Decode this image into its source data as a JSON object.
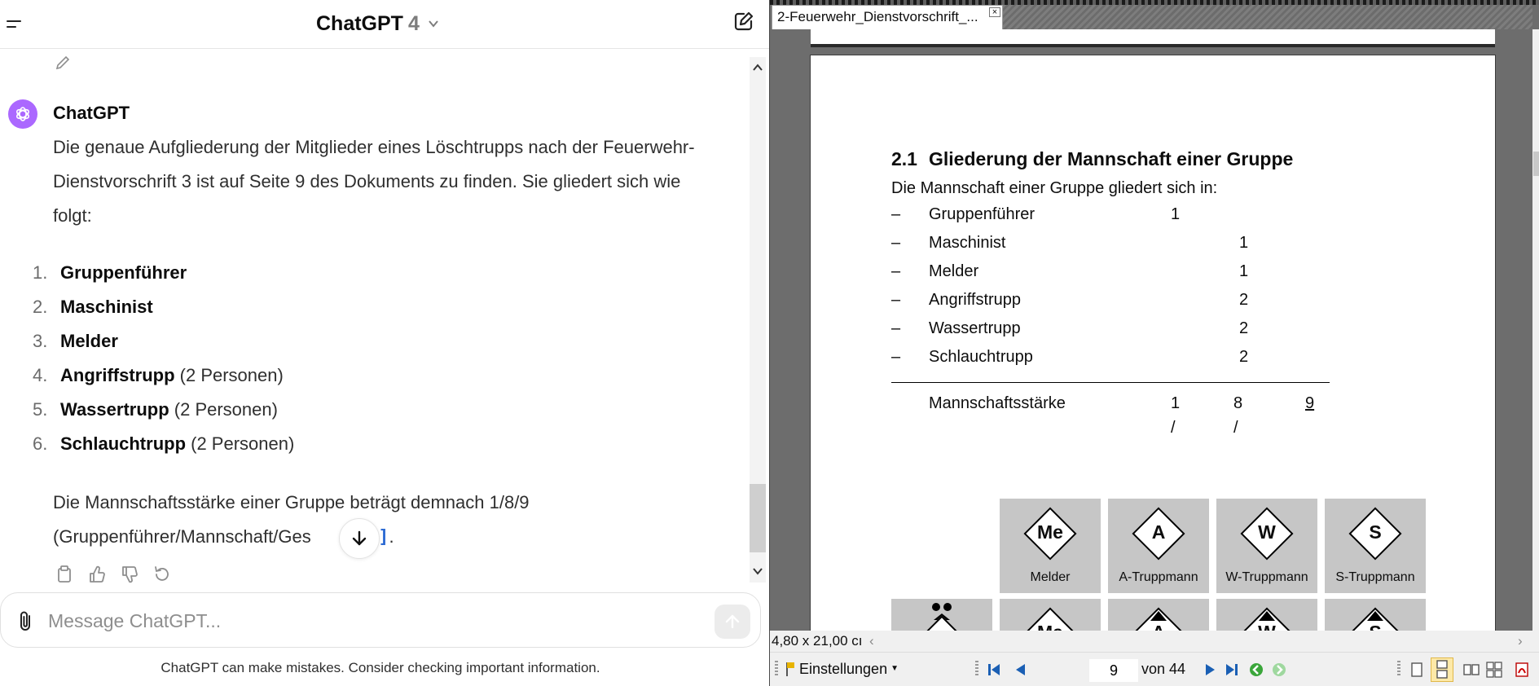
{
  "chat": {
    "model_name": "ChatGPT",
    "model_version": "4",
    "sender": "ChatGPT",
    "intro": "Die genaue Aufgliederung der Mitglieder eines Löschtrupps nach der Feuerwehr-Dienstvorschrift 3 ist auf Seite 9 des Dokuments zu finden. Sie gliedert sich wie folgt:",
    "list": [
      {
        "num": "1.",
        "bold": "Gruppenführer",
        "rest": ""
      },
      {
        "num": "2.",
        "bold": "Maschinist",
        "rest": ""
      },
      {
        "num": "3.",
        "bold": "Melder",
        "rest": ""
      },
      {
        "num": "4.",
        "bold": "Angriffstrupp",
        "rest": " (2 Personen)"
      },
      {
        "num": "5.",
        "bold": "Wassertrupp",
        "rest": " (2 Personen)"
      },
      {
        "num": "6.",
        "bold": "Schlauchtrupp",
        "rest": " (2 Personen)"
      }
    ],
    "summary_1": "Die Mannschaftsstärke einer Gruppe beträgt demnach 1/8/9",
    "summary_2": "(Gruppenführer/Mannschaft/Ges",
    "citation": "[”]",
    "summary_end": ".",
    "composer_placeholder": "Message ChatGPT...",
    "disclaimer": "ChatGPT can make mistakes. Consider checking important information."
  },
  "pdf": {
    "tab_title": "2-Feuerwehr_Dienstvorschrift_...",
    "tab_close": "×",
    "heading_num": "2.1",
    "heading_text": "Gliederung der Mannschaft einer Gruppe",
    "intro": "Die Mannschaft einer Gruppe gliedert sich in:",
    "rows": [
      {
        "dash": "–",
        "label": "Gruppenführer",
        "col1": "1",
        "col2": ""
      },
      {
        "dash": "–",
        "label": "Maschinist",
        "col1": "",
        "col2": "1"
      },
      {
        "dash": "–",
        "label": "Melder",
        "col1": "",
        "col2": "1"
      },
      {
        "dash": "–",
        "label": "Angriffstrupp",
        "col1": "",
        "col2": "2"
      },
      {
        "dash": "–",
        "label": "Wassertrupp",
        "col1": "",
        "col2": "2"
      },
      {
        "dash": "–",
        "label": "Schlauchtrupp",
        "col1": "",
        "col2": "2"
      }
    ],
    "total_label": "Mannschaftsstärke",
    "total_1": "1 /",
    "total_2": "8 /",
    "total_3": "9",
    "tiles_top": [
      {
        "letter": "Me",
        "caption": "Melder"
      },
      {
        "letter": "A",
        "caption": "A-Truppmann"
      },
      {
        "letter": "W",
        "caption": "W-Truppmann"
      },
      {
        "letter": "S",
        "caption": "S-Truppmann"
      }
    ],
    "tiles_bottom": [
      {
        "letter": ""
      },
      {
        "letter": "Ma"
      },
      {
        "letter": "A"
      },
      {
        "letter": "W"
      },
      {
        "letter": "S"
      }
    ],
    "page_size": "4,80 x 21,00 cı",
    "settings_label": "Einstellungen",
    "current_page": "9",
    "page_of": "von 44"
  }
}
